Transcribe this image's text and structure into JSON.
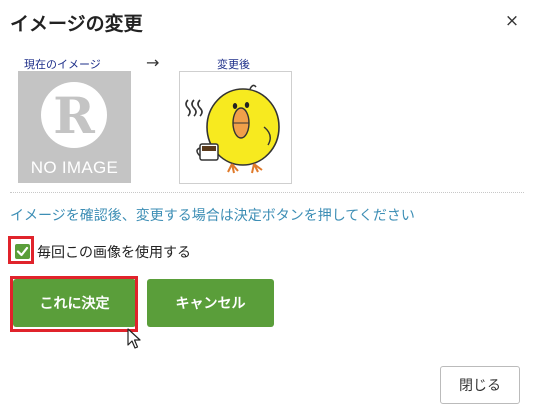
{
  "dialog": {
    "title": "イメージの変更",
    "close_symbol": "×"
  },
  "preview": {
    "current_label": "現在のイメージ",
    "arrow": "→",
    "after_label": "変更後",
    "noimage_text": "NO IMAGE",
    "noimage_logo": "R"
  },
  "info_text": "イメージを確認後、変更する場合は決定ボタンを押してください",
  "checkbox": {
    "label": "毎回この画像を使用する",
    "checked": true
  },
  "buttons": {
    "confirm": "これに決定",
    "cancel": "キャンセル",
    "close": "閉じる"
  },
  "colors": {
    "accent_green": "#5a9e3a",
    "highlight_red": "#e0232b",
    "info_blue": "#3d8eb5",
    "label_navy": "#1e2f8a"
  }
}
